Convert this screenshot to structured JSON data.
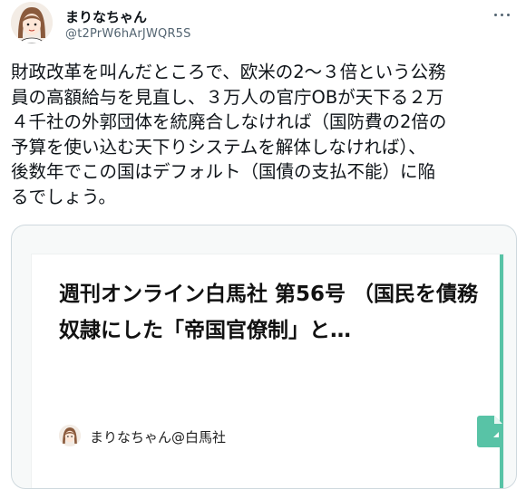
{
  "user": {
    "display_name": "まりなちゃん",
    "handle": "@t2PrW6hArJWQR5S"
  },
  "tweet": {
    "text": "財政改革を叫んだところで、欧米の2～３倍という公務\n員の高額給与を見直し、３万人の官庁OBが天下る２万\n４千社の外郭団体を統廃合しなければ（国防費の2倍の\n予算を使い込む天下りシステムを解体しなければ）、\n後数年でこの国はデフォルト（国債の支払不能）に陥\nるでしょう。"
  },
  "card": {
    "title": "週刊オンライン白馬社 第56号 （国民を債務奴隷にした「帝国官僚制」と…",
    "author": "まりなちゃん@白馬社",
    "accent_color": "#58c3a6"
  },
  "icons": {
    "more": "more-icon",
    "document": "document-icon"
  }
}
